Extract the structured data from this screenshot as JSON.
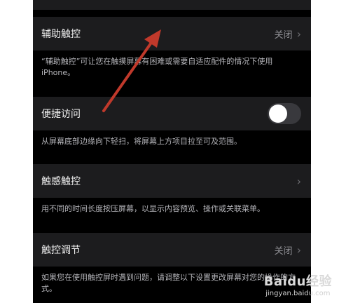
{
  "settings": {
    "assistive_touch": {
      "label": "辅助触控",
      "value": "关闭",
      "description": "“辅助触控”可让您在触摸屏幕有困难或需要自适应配件的情况下使用iPhone。"
    },
    "reachability": {
      "label": "便捷访问",
      "toggle_on": false,
      "description": "从屏幕底部边缘向下轻扫，将屏幕上方项目拉至可及范围。"
    },
    "haptic_touch": {
      "label": "触感触控",
      "description": "用不同的时间长度按压屏幕，以显示内容预览、操作或关联菜单。"
    },
    "touch_accommodations": {
      "label": "触控调节",
      "value": "关闭",
      "description": "如果您在使用触控屏时遇到问题，请调整以下设置更改屏幕对您的操作的方式。"
    }
  },
  "annotation": {
    "arrow_color": "#c0392b"
  },
  "watermark": {
    "brand": "Baidu经验",
    "site": "jingyan.baidu.com"
  },
  "colors": {
    "background": "#000000",
    "row": "#1c1c1e",
    "toggle_off": "#39393d"
  }
}
